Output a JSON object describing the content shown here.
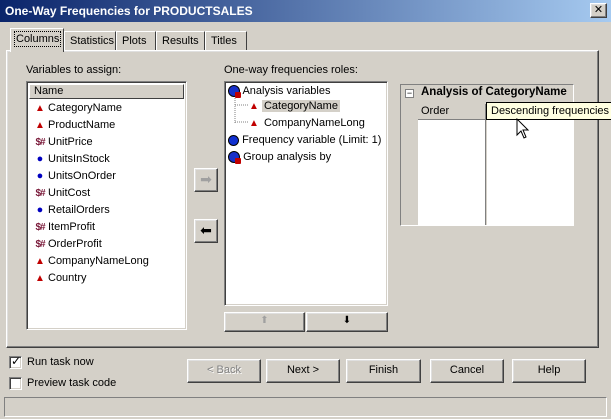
{
  "window": {
    "title": "One-Way Frequencies for PRODUCTSALES",
    "close_glyph": "✕"
  },
  "tabs": [
    {
      "label": "Columns",
      "active": true
    },
    {
      "label": "Statistics"
    },
    {
      "label": "Plots"
    },
    {
      "label": "Results"
    },
    {
      "label": "Titles"
    }
  ],
  "variables": {
    "label": "Variables to assign:",
    "header": "Name",
    "items": [
      {
        "name": "CategoryName",
        "icon": "character-icon"
      },
      {
        "name": "ProductName",
        "icon": "character-icon"
      },
      {
        "name": "UnitPrice",
        "icon": "computed-icon"
      },
      {
        "name": "UnitsInStock",
        "icon": "numeric-icon"
      },
      {
        "name": "UnitsOnOrder",
        "icon": "numeric-icon"
      },
      {
        "name": "UnitCost",
        "icon": "computed-icon"
      },
      {
        "name": "RetailOrders",
        "icon": "numeric-icon"
      },
      {
        "name": "ItemProfit",
        "icon": "computed-icon"
      },
      {
        "name": "OrderProfit",
        "icon": "computed-icon"
      },
      {
        "name": "CompanyNameLong",
        "icon": "character-icon"
      },
      {
        "name": "Country",
        "icon": "character-icon"
      }
    ]
  },
  "roles": {
    "label": "One-way frequencies roles:",
    "analysis_label": "Analysis variables",
    "analysis_items": [
      "CategoryName",
      "CompanyNameLong"
    ],
    "frequency_label": "Frequency variable  (Limit: 1)",
    "group_label": "Group analysis by"
  },
  "analysis_table": {
    "collapse_glyph": "−",
    "title": "Analysis of CategoryName",
    "col_order": "Order",
    "tooltip": "Descending frequencies"
  },
  "checkboxes": {
    "run_task": {
      "label": "Run task now",
      "checked": true
    },
    "preview": {
      "label": "Preview task code",
      "checked": false
    }
  },
  "buttons": {
    "back": "< Back",
    "next": "Next >",
    "finish": "Finish",
    "cancel": "Cancel",
    "help": "Help"
  },
  "glyphs": {
    "triangle": "▲",
    "circle": "●",
    "calc": "$#",
    "right_arrow": "➡",
    "left_arrow": "⬅",
    "up_arrow": "⬆",
    "down_arrow": "⬇",
    "check": "✓"
  }
}
